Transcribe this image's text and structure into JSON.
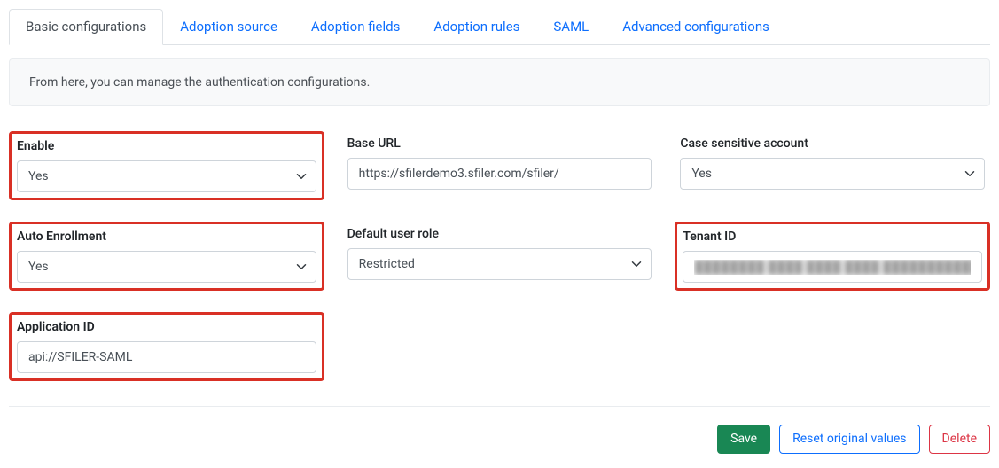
{
  "tabs": [
    {
      "label": "Basic configurations",
      "active": true
    },
    {
      "label": "Adoption source",
      "active": false
    },
    {
      "label": "Adoption fields",
      "active": false
    },
    {
      "label": "Adoption rules",
      "active": false
    },
    {
      "label": "SAML",
      "active": false
    },
    {
      "label": "Advanced configurations",
      "active": false
    }
  ],
  "info_text": "From here, you can manage the authentication configurations.",
  "fields": {
    "enable": {
      "label": "Enable",
      "value": "Yes"
    },
    "base_url": {
      "label": "Base URL",
      "value": "https://sfilerdemo3.sfiler.com/sfiler/"
    },
    "case_sensitive": {
      "label": "Case sensitive account",
      "value": "Yes"
    },
    "auto_enrollment": {
      "label": "Auto Enrollment",
      "value": "Yes"
    },
    "default_user_role": {
      "label": "Default user role",
      "value": "Restricted"
    },
    "tenant_id": {
      "label": "Tenant ID",
      "value": "████████ ████ ████ ████ ████████████"
    },
    "application_id": {
      "label": "Application ID",
      "value": "api://SFILER-SAML"
    }
  },
  "buttons": {
    "save": "Save",
    "reset": "Reset original values",
    "delete": "Delete"
  }
}
